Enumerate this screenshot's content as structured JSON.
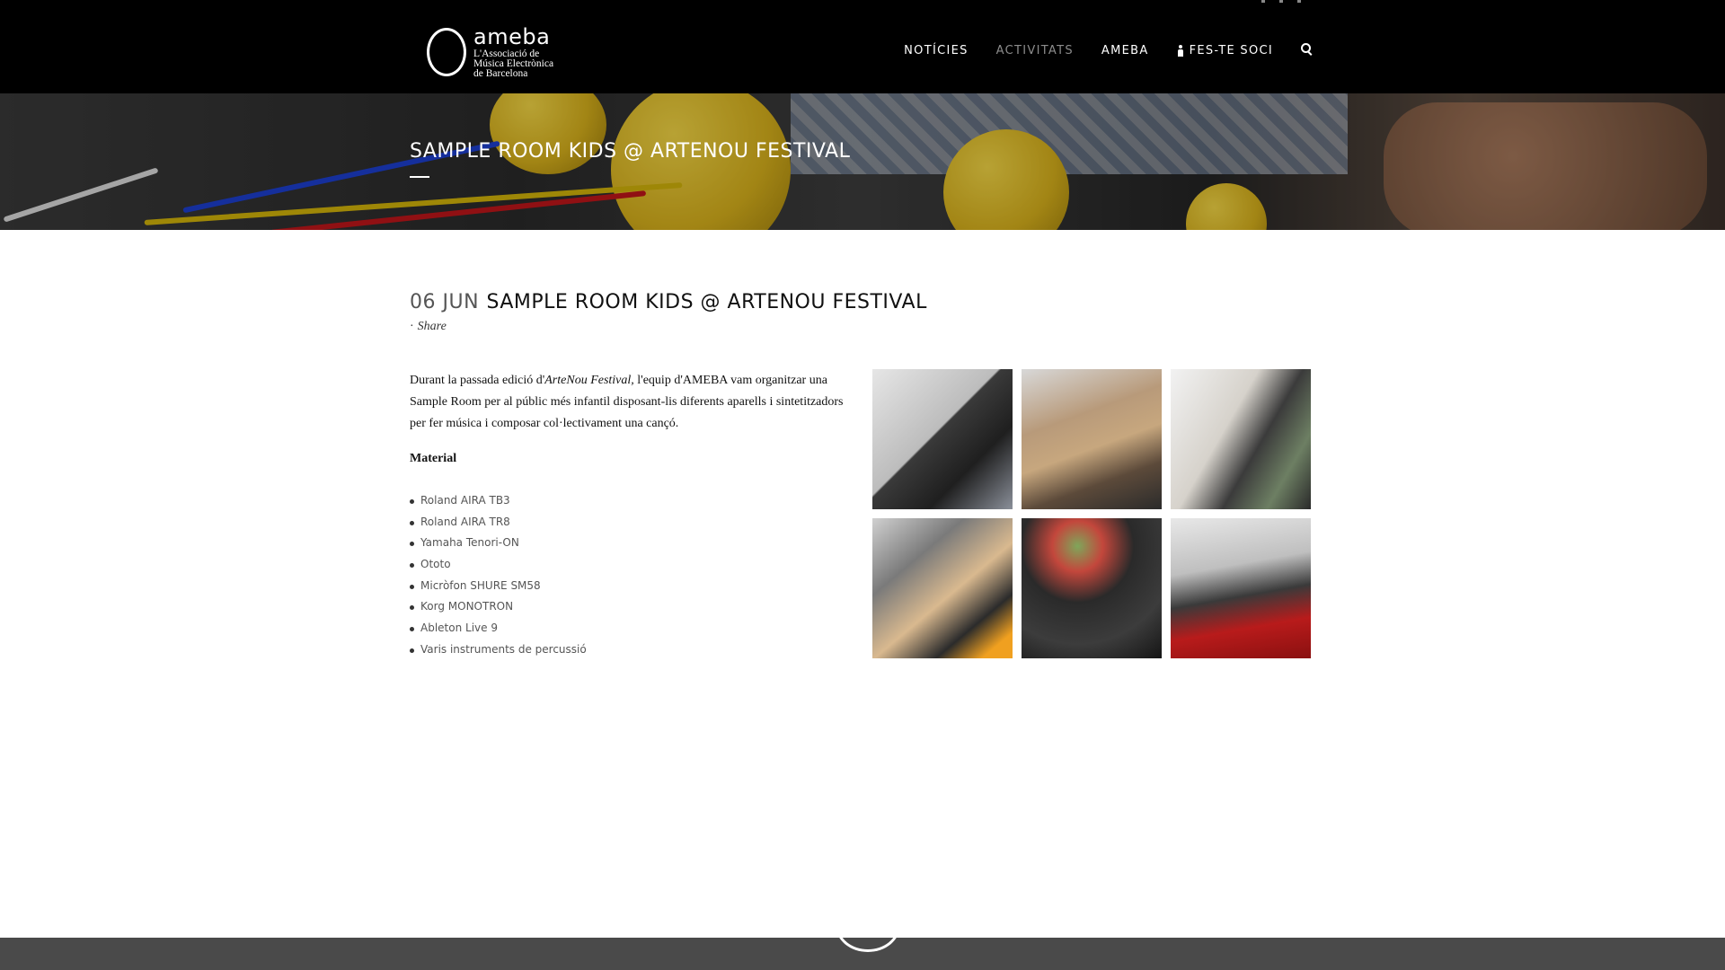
{
  "header": {
    "logo": {
      "name": "ameba",
      "subtitle_lines": [
        "L'Associació de",
        "Música Electrònica",
        "de Barcelona"
      ]
    },
    "nav": [
      {
        "label": "NOTÍCIES",
        "active": false
      },
      {
        "label": "ACTIVITATS",
        "active": true
      },
      {
        "label": "AMEBA",
        "active": false
      },
      {
        "label": "FES-TE SOCI",
        "icon": "person-icon",
        "active": false
      }
    ],
    "search_icon": "search-icon"
  },
  "hero": {
    "title": "SAMPLE ROOM KIDS @ ARTENOU FESTIVAL"
  },
  "post": {
    "date": "06 JUN",
    "title": "SAMPLE ROOM KIDS @ ARTENOU FESTIVAL",
    "share_label": "Share",
    "intro_before": "Durant la passada edició d'",
    "intro_italic": "ArteNou Festival,",
    "intro_after": " l'equip d'AMEBA vam organitzar una Sample Room per al públic més infantil disposant-lis diferents aparells i sintetitzadors per fer música i composar col·lectivament una cançó.",
    "material_heading": "Material",
    "materials": [
      "Roland AIRA TB3",
      "Roland AIRA TR8",
      "Yamaha Tenori-ON",
      "Ototo",
      "Micròfon SHURE SM58",
      "Korg MONOTRON",
      "Ableton Live 9",
      "Varis instruments de percussió"
    ]
  },
  "gallery": {
    "count": 6
  },
  "colors": {
    "header_bg": "#000000",
    "footer_bg": "#4a4a4a",
    "nav_active": "#8c8c8c"
  }
}
